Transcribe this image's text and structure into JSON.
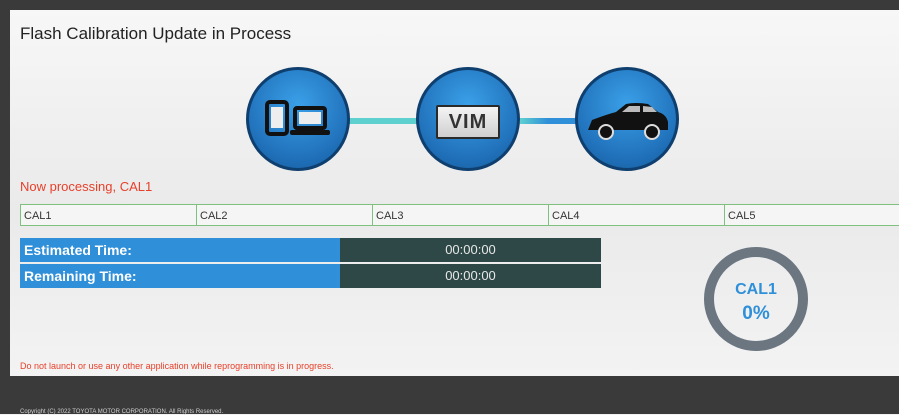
{
  "header": {
    "title": "Flash Calibration Update in Process"
  },
  "flow": {
    "vim_label": "VIM"
  },
  "status": {
    "processing_text": "Now processing, CAL1"
  },
  "calibrations": [
    "CAL1",
    "CAL2",
    "CAL3",
    "CAL4",
    "CAL5"
  ],
  "timing": {
    "estimated_label": "Estimated Time:",
    "estimated_value": "00:00:00",
    "remaining_label": "Remaining Time:",
    "remaining_value": "00:00:00"
  },
  "progress": {
    "current_cal": "CAL1",
    "percent_text": "0%"
  },
  "footer": {
    "warning": "Do not launch or use any other application while reprogramming is in progress.",
    "copyright": "Copyright (C) 2022 TOYOTA MOTOR CORPORATION. All Rights Reserved."
  },
  "colors": {
    "accent_blue": "#2f8fd8",
    "warning_red": "#e8402a",
    "time_value_bg": "#2d4846",
    "cal_border": "#7fc07f"
  }
}
